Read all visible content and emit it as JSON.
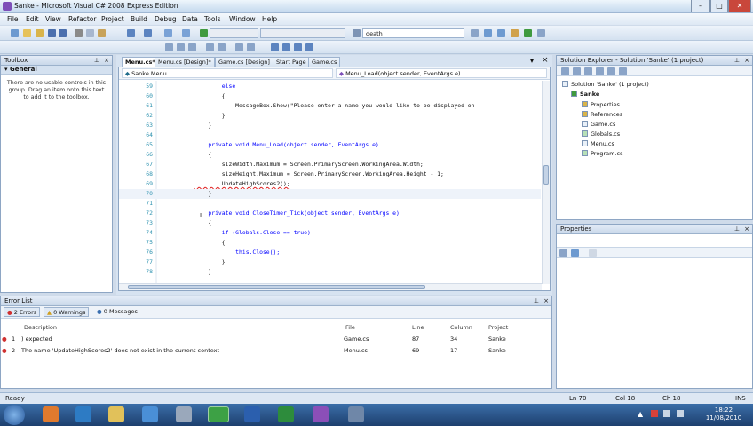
{
  "window": {
    "title": "Sanke - Microsoft Visual C# 2008 Express Edition",
    "min": "–",
    "max": "□",
    "close": "✕"
  },
  "menu": [
    "File",
    "Edit",
    "View",
    "Refactor",
    "Project",
    "Build",
    "Debug",
    "Data",
    "Tools",
    "Window",
    "Help"
  ],
  "toolbar": {
    "find_combo": "death"
  },
  "toolbox": {
    "title": "Toolbox",
    "group": "General",
    "empty_text": "There are no usable controls in this group. Drag an item onto this text to add it to the toolbox."
  },
  "editor": {
    "tabs": [
      "Menu.cs*",
      "Menu.cs [Design]*",
      "Game.cs [Design]",
      "Start Page",
      "Game.cs"
    ],
    "class_combo": "Sanke.Menu",
    "member_combo": "Menu_Load(object sender, EventArgs e)",
    "lines": [
      {
        "n": "59",
        "t": "        else"
      },
      {
        "n": "60",
        "t": "        {"
      },
      {
        "n": "61",
        "t": "            MessageBox.Show(\"Please enter a name you would like to be displayed on"
      },
      {
        "n": "62",
        "t": "        }"
      },
      {
        "n": "63",
        "t": "    }"
      },
      {
        "n": "64",
        "t": ""
      },
      {
        "n": "65",
        "t": "    private void Menu_Load(object sender, EventArgs e)"
      },
      {
        "n": "66",
        "t": "    {"
      },
      {
        "n": "67",
        "t": "        sizeWidth.Maximum = Screen.PrimaryScreen.WorkingArea.Width;"
      },
      {
        "n": "68",
        "t": "        sizeHeight.Maximum = Screen.PrimaryScreen.WorkingArea.Height - 1;"
      },
      {
        "n": "69",
        "t": "        UpdateHighScores2();"
      },
      {
        "n": "70",
        "t": "    }"
      },
      {
        "n": "71",
        "t": ""
      },
      {
        "n": "72",
        "t": "    private void CloseTimer_Tick(object sender, EventArgs e)"
      },
      {
        "n": "73",
        "t": "    {"
      },
      {
        "n": "74",
        "t": "        if (Globals.Close == true)"
      },
      {
        "n": "75",
        "t": "        {"
      },
      {
        "n": "76",
        "t": "            this.Close();"
      },
      {
        "n": "77",
        "t": "        }"
      },
      {
        "n": "78",
        "t": "    }"
      }
    ]
  },
  "solution_explorer": {
    "title": "Solution Explorer - Solution 'Sanke' (1 project)",
    "items": [
      "Solution 'Sanke' (1 project)",
      "Sanke",
      "Properties",
      "References",
      "Game.cs",
      "Globals.cs",
      "Menu.cs",
      "Program.cs"
    ]
  },
  "properties": {
    "title": "Properties"
  },
  "error_list": {
    "title": "Error List",
    "filters": [
      "2 Errors",
      "0 Warnings",
      "0 Messages"
    ],
    "columns": [
      "Description",
      "File",
      "Line",
      "Column",
      "Project"
    ],
    "rows": [
      {
        "num": "1",
        "desc": ") expected",
        "file": "Game.cs",
        "line": "87",
        "col": "34",
        "project": "Sanke"
      },
      {
        "num": "2",
        "desc": "The name 'UpdateHighScores2' does not exist in the current context",
        "file": "Menu.cs",
        "line": "69",
        "col": "17",
        "project": "Sanke"
      }
    ]
  },
  "status": {
    "text": "Ready",
    "ln": "Ln 70",
    "col": "Col 18",
    "ch": "Ch 18",
    "ins": "INS"
  },
  "clock": {
    "time": "18:22",
    "date": "11/08/2010"
  }
}
